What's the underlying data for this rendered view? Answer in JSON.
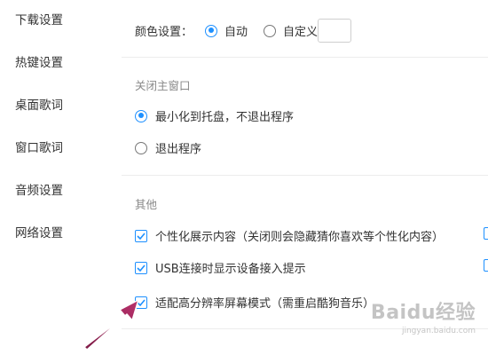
{
  "sidebar": {
    "items": [
      {
        "label": "下载设置"
      },
      {
        "label": "热键设置"
      },
      {
        "label": "桌面歌词"
      },
      {
        "label": "窗口歌词"
      },
      {
        "label": "音频设置"
      },
      {
        "label": "网络设置"
      }
    ]
  },
  "color_setting": {
    "label": "颜色设置：",
    "options": [
      {
        "label": "自动",
        "checked": true
      },
      {
        "label": "自定义",
        "checked": false
      }
    ]
  },
  "close_window": {
    "title": "关闭主窗口",
    "options": [
      {
        "label": "最小化到托盘，不退出程序",
        "checked": true
      },
      {
        "label": "退出程序",
        "checked": false
      }
    ]
  },
  "other": {
    "title": "其他",
    "options": [
      {
        "label": "个性化展示内容（关闭则会隐藏猜你喜欢等个性化内容）",
        "checked": true
      },
      {
        "label": "USB连接时显示设备接入提示",
        "checked": true
      },
      {
        "label": "适配高分辨率屏幕模式（需重启酷狗音乐）",
        "checked": true
      }
    ]
  },
  "watermark": {
    "logo": "Baidu经验",
    "url": "jingyan.baidu.com"
  },
  "colors": {
    "accent": "#1e90ff",
    "arrow": "#a3245a"
  }
}
